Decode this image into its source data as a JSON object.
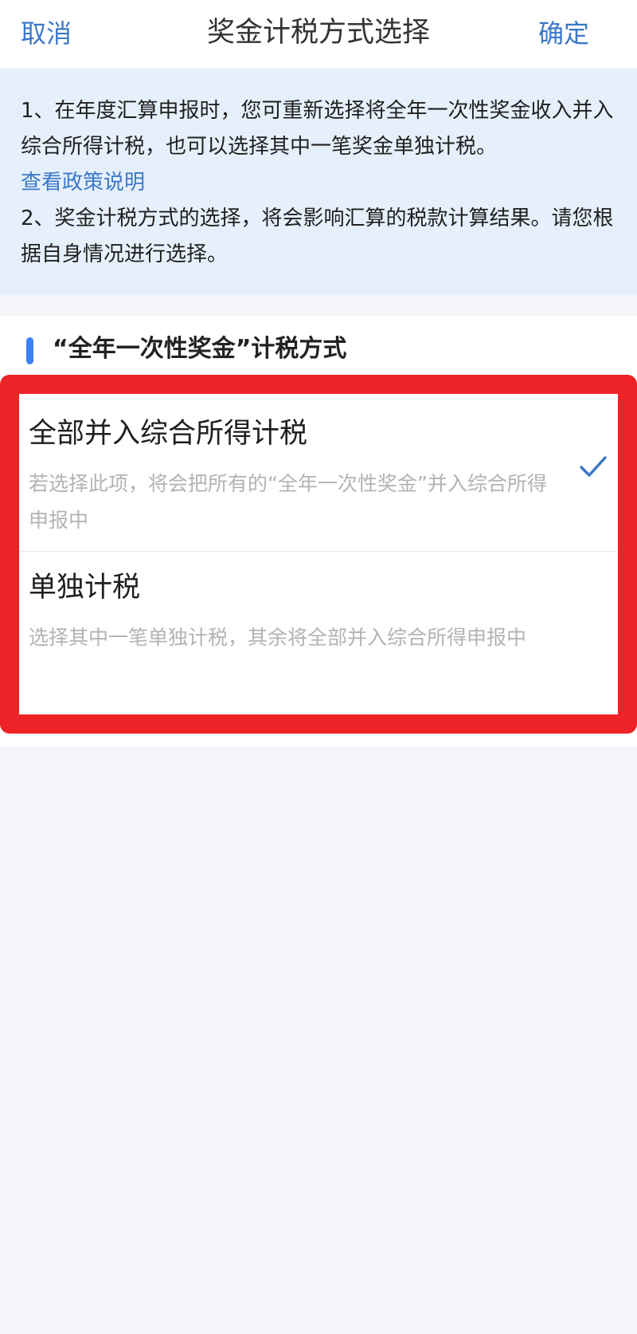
{
  "header": {
    "cancel_label": "取消",
    "title": "奖金计税方式选择",
    "confirm_label": "确定"
  },
  "notice": {
    "line1": "1、在年度汇算申报时，您可重新选择将全年一次性奖金收入并入综合所得计税，也可以选择其中一笔奖金单独计税。",
    "policy_link": "查看政策说明",
    "line2": "2、奖金计税方式的选择，将会影响汇算的税款计算结果。请您根据自身情况进行选择。"
  },
  "section": {
    "title": "“全年一次性奖金”计税方式"
  },
  "options": [
    {
      "title": "全部并入综合所得计税",
      "description": "若选择此项，将会把所有的“全年一次性奖金”并入综合所得申报中",
      "selected": true
    },
    {
      "title": "单独计税",
      "description": "选择其中一笔单独计税，其余将全部并入综合所得申报中",
      "selected": false
    }
  ],
  "colors": {
    "accent": "#3b78c9",
    "highlight_frame": "#ee2328",
    "notice_bg": "#e6f0fc"
  },
  "icons": {
    "selected_mark": "checkmark-icon"
  }
}
